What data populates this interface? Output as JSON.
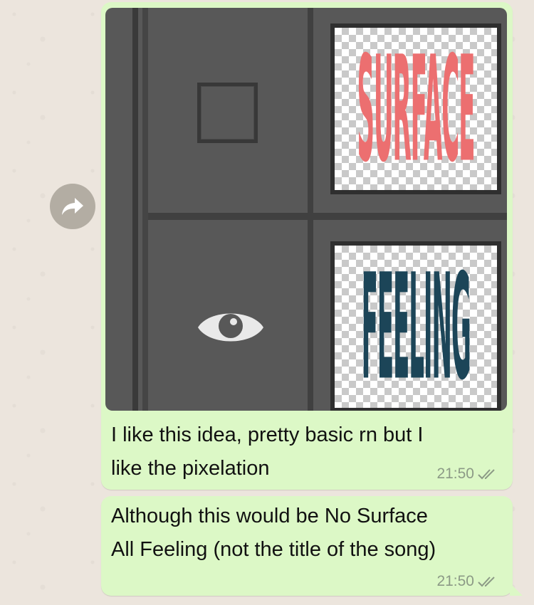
{
  "forward_button": {
    "icon": "forward-arrow-icon"
  },
  "messages": [
    {
      "text": "I like this idea, pretty basic rn but I\nlike the pixelation",
      "time": "21:50",
      "status_icon": "double-check-icon",
      "image": {
        "top_label": "SURFACE",
        "bottom_label": "FEELING",
        "top_label_color": "#ec6f70",
        "bottom_label_color": "#1c4558",
        "icons": [
          "square-icon",
          "eye-icon"
        ]
      }
    },
    {
      "text": "Although this would be No Surface\nAll Feeling (not the title of the song)",
      "time": "21:50",
      "status_icon": "double-check-icon"
    }
  ],
  "colors": {
    "bubble": "#dcf8c6",
    "wallpaper": "#ece5dd",
    "timestamp": "#8c9a86"
  }
}
